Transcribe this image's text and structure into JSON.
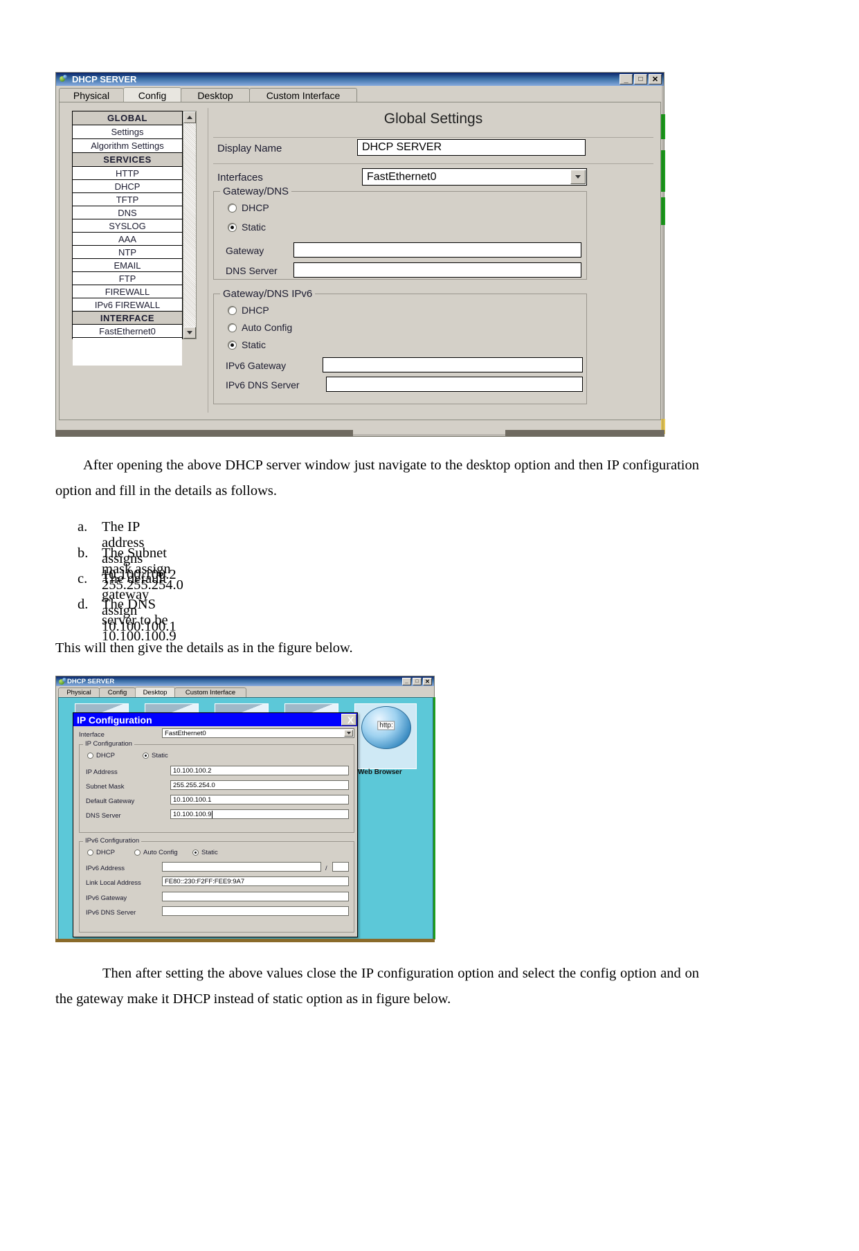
{
  "figure1": {
    "window_title": "DHCP SERVER",
    "window_buttons": {
      "minimize": "_",
      "maximize": "□",
      "close": "✕"
    },
    "tabs": [
      {
        "label": "Physical",
        "active": false
      },
      {
        "label": "Config",
        "active": true
      },
      {
        "label": "Desktop",
        "active": false
      },
      {
        "label": "Custom Interface",
        "active": false
      }
    ],
    "sidebar": [
      {
        "label": "GLOBAL",
        "type": "header"
      },
      {
        "label": "Settings",
        "type": "item"
      },
      {
        "label": "Algorithm Settings",
        "type": "item"
      },
      {
        "label": "SERVICES",
        "type": "header"
      },
      {
        "label": "HTTP",
        "type": "item"
      },
      {
        "label": "DHCP",
        "type": "item"
      },
      {
        "label": "TFTP",
        "type": "item"
      },
      {
        "label": "DNS",
        "type": "item"
      },
      {
        "label": "SYSLOG",
        "type": "item"
      },
      {
        "label": "AAA",
        "type": "item"
      },
      {
        "label": "NTP",
        "type": "item"
      },
      {
        "label": "EMAIL",
        "type": "item"
      },
      {
        "label": "FTP",
        "type": "item"
      },
      {
        "label": "FIREWALL",
        "type": "item"
      },
      {
        "label": "IPv6 FIREWALL",
        "type": "item"
      },
      {
        "label": "INTERFACE",
        "type": "header"
      },
      {
        "label": "FastEthernet0",
        "type": "item"
      }
    ],
    "panel_title": "Global Settings",
    "display_name_label": "Display Name",
    "display_name_value": "DHCP SERVER",
    "interfaces_label": "Interfaces",
    "interfaces_value": "FastEthernet0",
    "gateway_dns": {
      "legend": "Gateway/DNS",
      "radio_dhcp": "DHCP",
      "radio_static": "Static",
      "selected": "Static",
      "gateway_label": "Gateway",
      "gateway_value": "",
      "dns_label": "DNS Server",
      "dns_value": ""
    },
    "gateway_dns_ipv6": {
      "legend": "Gateway/DNS IPv6",
      "radio_dhcp": "DHCP",
      "radio_auto": "Auto Config",
      "radio_static": "Static",
      "selected": "Static",
      "gateway_label": "IPv6 Gateway",
      "gateway_value": "",
      "dns_label": "IPv6 DNS Server",
      "dns_value": ""
    }
  },
  "text": {
    "para1": "After opening the above DHCP server window just navigate to the desktop option and then IP configuration option and fill in the details as follows.",
    "list": [
      {
        "marker": "a.",
        "text": "The IP address assigns 10.100.100.2"
      },
      {
        "marker": "b.",
        "text": "The Subnet mask assign  255.255.254.0"
      },
      {
        "marker": "c.",
        "text": "The default gateway assign 10.100.100.1"
      },
      {
        "marker": "d.",
        "text": "The DNS server to be 10.100.100.9"
      }
    ],
    "para2": "This will then give the details as in the figure below.",
    "para3": "Then after setting the above values close the IP configuration option and select the config option and on the gateway make it DHCP instead of static option as in figure below."
  },
  "figure2": {
    "window_title": "DHCP SERVER",
    "window_buttons": {
      "minimize": "_",
      "maximize": "□",
      "close": "✕"
    },
    "tabs": [
      {
        "label": "Physical",
        "active": false
      },
      {
        "label": "Config",
        "active": false
      },
      {
        "label": "Desktop",
        "active": true
      },
      {
        "label": "Custom Interface",
        "active": false
      }
    ],
    "dialog": {
      "title": "IP Configuration",
      "close_label": "X",
      "interface_label": "Interface",
      "interface_value": "FastEthernet0",
      "ip_config": {
        "legend": "IP Configuration",
        "radio_dhcp": "DHCP",
        "radio_static": "Static",
        "selected": "Static",
        "rows": [
          {
            "label": "IP Address",
            "value": "10.100.100.2"
          },
          {
            "label": "Subnet Mask",
            "value": "255.255.254.0"
          },
          {
            "label": "Default Gateway",
            "value": "10.100.100.1"
          },
          {
            "label": "DNS Server",
            "value": "10.100.100.9"
          }
        ]
      },
      "ipv6_config": {
        "legend": "IPv6 Configuration",
        "radio_dhcp": "DHCP",
        "radio_auto": "Auto Config",
        "radio_static": "Static",
        "selected": "Static",
        "rows": [
          {
            "label": "IPv6 Address",
            "value": ""
          },
          {
            "label": "Link Local Address",
            "value": "FE80::230:F2FF:FEE9:9A7"
          },
          {
            "label": "IPv6 Gateway",
            "value": ""
          },
          {
            "label": "IPv6 DNS Server",
            "value": ""
          }
        ],
        "prefix_separator": "/",
        "prefix_value": ""
      }
    },
    "web_browser": {
      "label": "Web Browser",
      "icon_text": "http:"
    }
  }
}
